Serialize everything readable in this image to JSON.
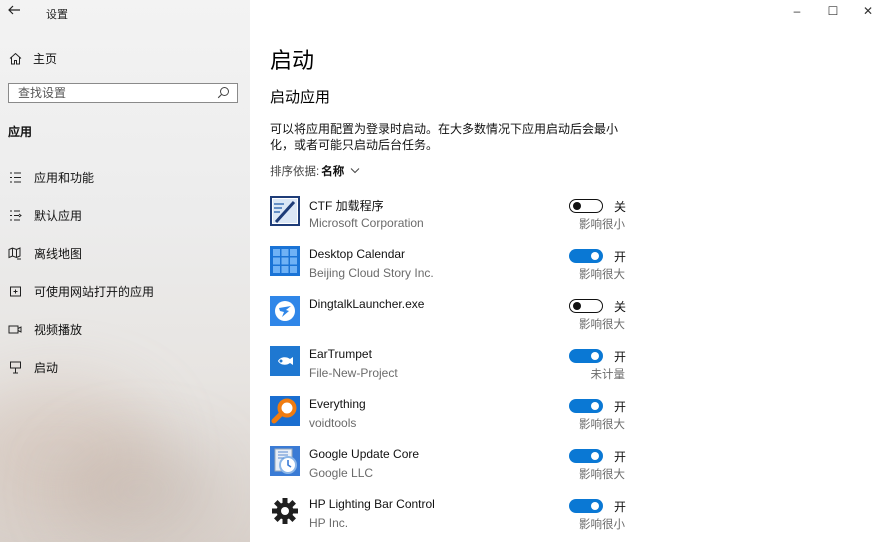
{
  "window": {
    "title": "设置",
    "minimize": "–",
    "maximize": "☐",
    "close": "✕"
  },
  "sidebar": {
    "home_label": "主页",
    "search_placeholder": "查找设置",
    "section_title": "应用",
    "items": [
      {
        "label": "应用和功能",
        "icon": "apps-features-icon"
      },
      {
        "label": "默认应用",
        "icon": "default-apps-icon"
      },
      {
        "label": "离线地图",
        "icon": "offline-maps-icon"
      },
      {
        "label": "可使用网站打开的应用",
        "icon": "apps-for-websites-icon"
      },
      {
        "label": "视频播放",
        "icon": "video-playback-icon"
      },
      {
        "label": "启动",
        "icon": "startup-icon"
      }
    ]
  },
  "main": {
    "title": "启动",
    "subtitle": "启动应用",
    "description": "可以将应用配置为登录时启动。在大多数情况下应用启动后会最小化，或者可能只启动后台任务。",
    "sort_label": "排序依据:",
    "sort_value": "名称",
    "apps": [
      {
        "name": "CTF 加载程序",
        "publisher": "Microsoft Corporation",
        "on": false,
        "state": "关",
        "impact": "影响很小",
        "icon": "ctf-loader-icon",
        "color": "#1e5aa8"
      },
      {
        "name": "Desktop Calendar",
        "publisher": "Beijing Cloud Story Inc.",
        "on": true,
        "state": "开",
        "impact": "影响很大",
        "icon": "calendar-grid-icon",
        "color": "#1a73d6"
      },
      {
        "name": "DingtalkLauncher.exe",
        "publisher": "",
        "on": false,
        "state": "关",
        "impact": "影响很大",
        "icon": "dingtalk-icon",
        "color": "#2f86e8"
      },
      {
        "name": "EarTrumpet",
        "publisher": "File-New-Project",
        "on": true,
        "state": "开",
        "impact": "未计量",
        "icon": "eartrumpet-icon",
        "color": "#1f78d1"
      },
      {
        "name": "Everything",
        "publisher": "voidtools",
        "on": true,
        "state": "开",
        "impact": "影响很大",
        "icon": "magnifier-icon",
        "color": "#f07c10"
      },
      {
        "name": "Google Update Core",
        "publisher": "Google LLC",
        "on": true,
        "state": "开",
        "impact": "影响很大",
        "icon": "google-update-icon",
        "color": "#3a7bd5"
      },
      {
        "name": "HP Lighting Bar Control",
        "publisher": "HP Inc.",
        "on": true,
        "state": "开",
        "impact": "影响很小",
        "icon": "gear-icon",
        "color": "#1f1f1f"
      }
    ]
  },
  "colors": {
    "accent": "#0a78d4",
    "secondary_text": "#6b6b6b"
  }
}
